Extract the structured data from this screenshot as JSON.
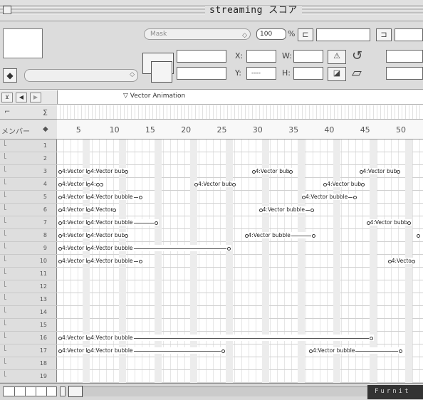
{
  "window": {
    "title": "streaming スコア"
  },
  "toolbar": {
    "ink_popup_value": "Mask",
    "blend_value": "100",
    "blend_unit": "%",
    "x_label": "X:",
    "y_label": "Y:",
    "y_value": "----",
    "w_label": "W:",
    "h_label": "H:"
  },
  "timeline": {
    "tab_title": "Vector Animation",
    "channel_popup": "メンバー",
    "frame_ticks": [
      "5",
      "10",
      "15",
      "20",
      "25",
      "30",
      "35",
      "40",
      "45",
      "50"
    ],
    "rows": [
      {
        "num": "1",
        "sprites": []
      },
      {
        "num": "2",
        "sprites": []
      },
      {
        "num": "3",
        "sprites": [
          {
            "frame": 1,
            "text": "4:Vector bubb",
            "line_w": 0
          },
          {
            "frame": 5,
            "text": "4:Vector bub",
            "line_w": 0
          },
          {
            "frame": 28,
            "text": "4:Vector bub",
            "line_w": 0
          },
          {
            "frame": 43,
            "text": "4:Vector bub",
            "line_w": 0
          }
        ]
      },
      {
        "num": "4",
        "sprites": [
          {
            "frame": 1,
            "text": "4:Vector bubb",
            "line_w": 0
          },
          {
            "frame": 5,
            "text": "4:",
            "line_w": 0
          },
          {
            "frame": 20,
            "text": "4:Vector bub",
            "line_w": 0
          },
          {
            "frame": 38,
            "text": "4:Vector bub",
            "line_w": 0
          }
        ]
      },
      {
        "num": "5",
        "sprites": [
          {
            "frame": 1,
            "text": "4:Vector bubb",
            "line_w": 0
          },
          {
            "frame": 5,
            "text": "4:Vector bubble",
            "line_w": 6
          },
          {
            "frame": 35,
            "text": "4:Vector bubble",
            "line_w": 6
          }
        ]
      },
      {
        "num": "6",
        "sprites": [
          {
            "frame": 1,
            "text": "4:Vector bubb",
            "line_w": 0
          },
          {
            "frame": 5,
            "text": "4:Vector",
            "line_w": 0
          },
          {
            "frame": 29,
            "text": "4:Vector bubble",
            "line_w": 6
          }
        ]
      },
      {
        "num": "7",
        "sprites": [
          {
            "frame": 1,
            "text": "4:Vector bubb",
            "line_w": 0
          },
          {
            "frame": 5,
            "text": "4:Vector bubble",
            "line_w": 28
          },
          {
            "frame": 44,
            "text": "4:Vector bubb",
            "line_w": 0
          }
        ]
      },
      {
        "num": "8",
        "sprites": [
          {
            "frame": 1,
            "text": "4:Vector bubb",
            "line_w": 0
          },
          {
            "frame": 5,
            "text": "4:Vector bub",
            "line_w": 0
          },
          {
            "frame": 27,
            "text": "4:Vector bubble",
            "line_w": 28
          },
          {
            "frame": 51,
            "text": "",
            "line_w": 0
          }
        ]
      },
      {
        "num": "9",
        "sprites": [
          {
            "frame": 1,
            "text": "4:Vector bubb",
            "line_w": 0
          },
          {
            "frame": 5,
            "text": "4:Vector bubble",
            "line_w": 130
          }
        ]
      },
      {
        "num": "10",
        "sprites": [
          {
            "frame": 1,
            "text": "4:Vector bubb",
            "line_w": 0
          },
          {
            "frame": 5,
            "text": "4:Vector bubble",
            "line_w": 6
          },
          {
            "frame": 47,
            "text": "4:Vecto",
            "line_w": 0
          }
        ]
      },
      {
        "num": "11",
        "sprites": []
      },
      {
        "num": "12",
        "sprites": []
      },
      {
        "num": "13",
        "sprites": []
      },
      {
        "num": "14",
        "sprites": []
      },
      {
        "num": "15",
        "sprites": []
      },
      {
        "num": "16",
        "sprites": [
          {
            "frame": 1,
            "text": "4:Vector bubb",
            "line_w": 0
          },
          {
            "frame": 5,
            "text": "4:Vector bubble",
            "line_w": 330
          }
        ]
      },
      {
        "num": "17",
        "sprites": [
          {
            "frame": 1,
            "text": "4:Vector bubb",
            "line_w": 0
          },
          {
            "frame": 5,
            "text": "4:Vector bubble",
            "line_w": 122
          },
          {
            "frame": 36,
            "text": "4:Vector bubble",
            "line_w": 60
          }
        ]
      },
      {
        "num": "18",
        "sprites": []
      },
      {
        "num": "19",
        "sprites": []
      }
    ]
  },
  "statusbar": {
    "label": "Furnit"
  }
}
